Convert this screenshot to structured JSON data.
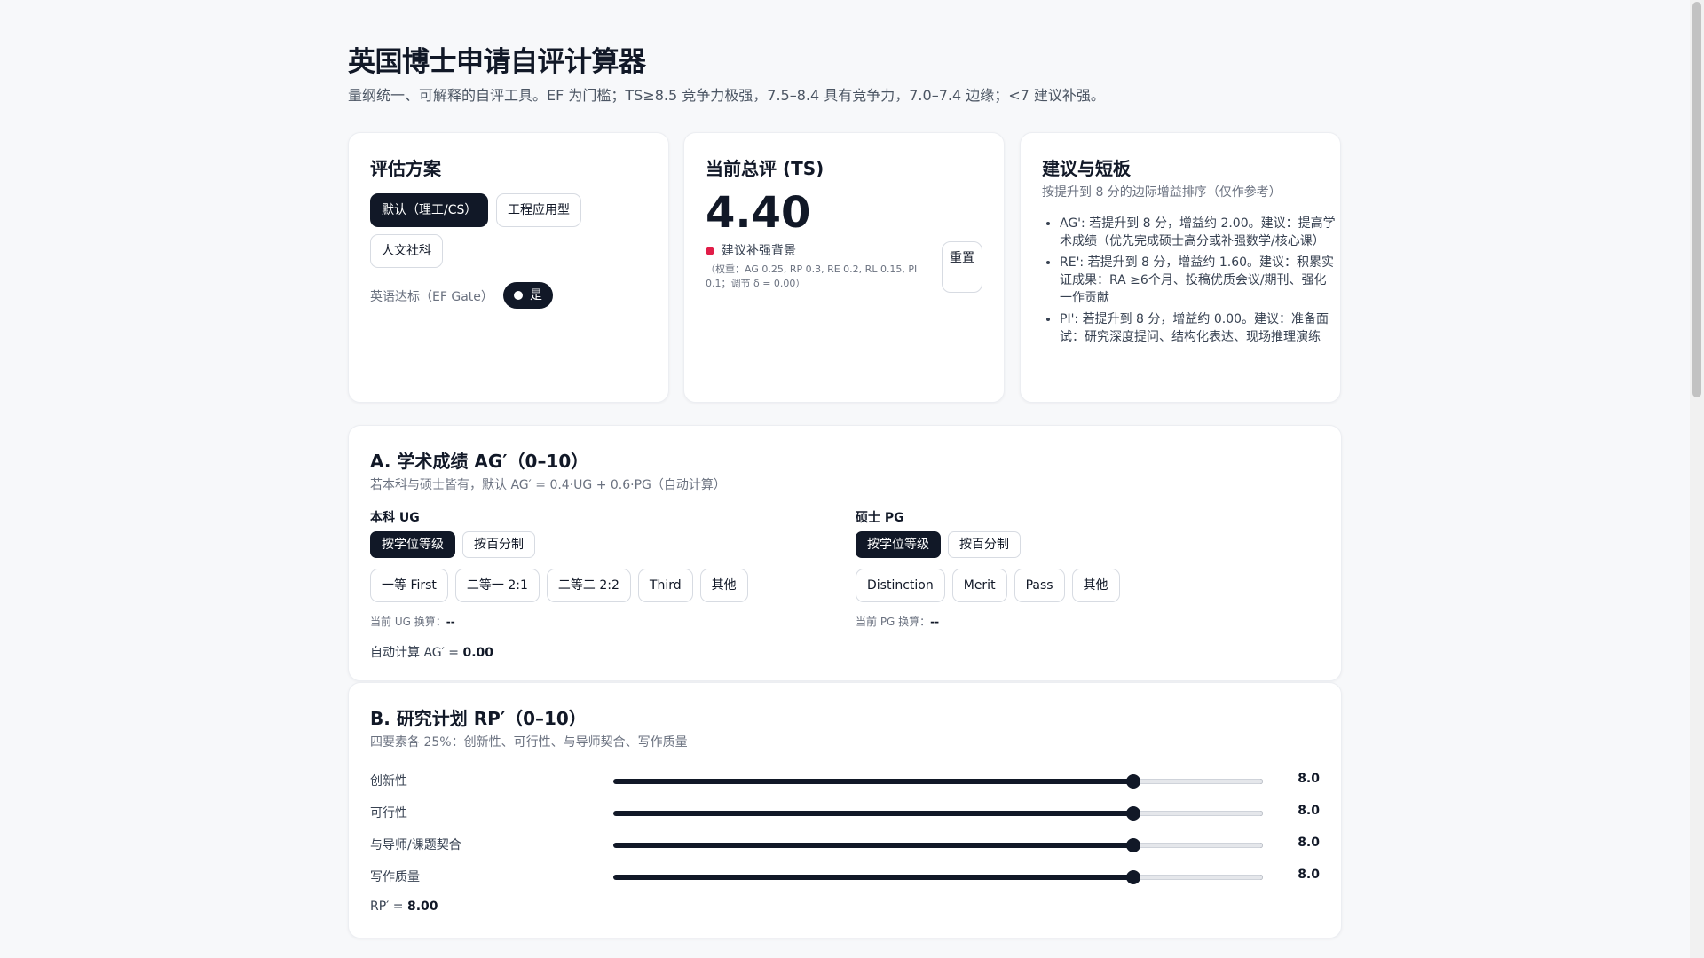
{
  "header": {
    "title": "英国博士申请自评计算器",
    "subtitle": "量纲统一、可解释的自评工具。EF 为门槛；TS≥8.5 竞争力极强，7.5–8.4 具有竞争力，7.0–7.4 边缘；<7 建议补强。"
  },
  "scheme": {
    "title": "评估方案",
    "options": [
      "默认（理工/CS）",
      "工程应用型",
      "人文社科"
    ],
    "active_index": 0,
    "ef_label": "英语达标（EF Gate）",
    "ef_toggle_label": "是",
    "ef_on": true
  },
  "total": {
    "title": "当前总评 (TS)",
    "score": "4.40",
    "status": "建议补强背景",
    "status_color": "#e11d48",
    "weights": "（权重：AG 0.25, RP 0.3, RE 0.2, RL 0.15, PI 0.1；调节 δ = 0.00）",
    "reset_label": "重置"
  },
  "suggestions": {
    "title": "建议与短板",
    "subtitle": "按提升到 8 分的边际增益排序（仅作参考）",
    "items": [
      "AG': 若提升到 8 分，增益约 2.00。建议：提高学术成绩（优先完成硕士高分或补强数学/核心课）",
      "RE': 若提升到 8 分，增益约 1.60。建议：积累实证成果：RA ≥6个月、投稿优质会议/期刊、强化一作贡献",
      "PI': 若提升到 8 分，增益约 0.00。建议：准备面试：研究深度提问、结构化表达、现场推理演练"
    ]
  },
  "section_a": {
    "title": "A. 学术成绩 AG′（0–10）",
    "subtitle": "若本科与硕士皆有，默认 AG′ = 0.4·UG + 0.6·PG（自动计算）",
    "ug": {
      "label": "本科 UG",
      "modes": [
        "按学位等级",
        "按百分制"
      ],
      "grades": [
        "一等 First",
        "二等一 2:1",
        "二等二 2:2",
        "Third",
        "其他"
      ],
      "conv_label": "当前 UG 换算：",
      "conv_value": "--"
    },
    "pg": {
      "label": "硕士 PG",
      "modes": [
        "按学位等级",
        "按百分制"
      ],
      "grades": [
        "Distinction",
        "Merit",
        "Pass",
        "其他"
      ],
      "conv_label": "当前 PG 换算：",
      "conv_value": "--"
    },
    "calc_label": "自动计算 AG′ = ",
    "calc_value": "0.00"
  },
  "section_b": {
    "title": "B. 研究计划 RP′（0–10）",
    "subtitle": "四要素各 25%：创新性、可行性、与导师契合、写作质量",
    "sliders": [
      {
        "label": "创新性",
        "value": 8.0,
        "display": "8.0"
      },
      {
        "label": "可行性",
        "value": 8.0,
        "display": "8.0"
      },
      {
        "label": "与导师/课题契合",
        "value": 8.0,
        "display": "8.0"
      },
      {
        "label": "写作质量",
        "value": 8.0,
        "display": "8.0"
      }
    ],
    "max": 10,
    "result_label": "RP′ = ",
    "result_value": "8.00"
  }
}
